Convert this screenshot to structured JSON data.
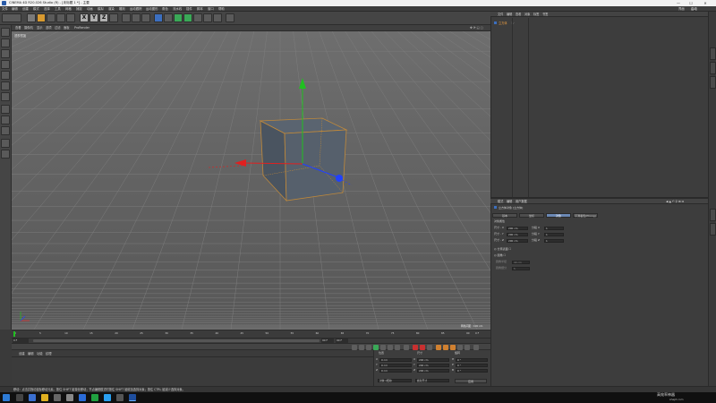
{
  "window": {
    "title": "CINEMA 4D R20.026 Studio (R) - [未标题 1 *] - 主要",
    "min": "—",
    "max": "☐",
    "close": "✕"
  },
  "menu": {
    "items": [
      "文件",
      "编辑",
      "创建",
      "模式",
      "选择",
      "工具",
      "网格",
      "捕捉",
      "动画",
      "模拟",
      "渲染",
      "雕刻",
      "运动跟踪",
      "运动图形",
      "角色",
      "流水线",
      "插件",
      "脚本",
      "窗口",
      "帮助"
    ],
    "layout_label": "界面",
    "layout_value": "启动"
  },
  "viewport": {
    "header": [
      "查看",
      "摄像机",
      "显示",
      "选项",
      "过滤",
      "面板",
      "ProRender"
    ],
    "view_name": "透视视图",
    "grid_spacing": "网格间距 : 100 cm"
  },
  "timeline": {
    "ticks": [
      "0",
      "5",
      "10",
      "15",
      "20",
      "25",
      "30",
      "35",
      "40",
      "45",
      "50",
      "55",
      "60",
      "65",
      "70",
      "75",
      "80",
      "85",
      "90"
    ],
    "frame_current": "0 F",
    "frame_start": "0 F",
    "frame_end": "90 F",
    "frame_end2": "90 F",
    "frame_label": "0 F"
  },
  "material": {
    "tabs": [
      "创建",
      "编辑",
      "功能",
      "纹理"
    ]
  },
  "coords": {
    "headers": [
      "位置",
      "尺寸",
      "旋转"
    ],
    "rows": [
      {
        "axis": "X",
        "pos": "0 cm",
        "size": "200 cm",
        "rot_label": "H",
        "rot": "0 °"
      },
      {
        "axis": "Y",
        "pos": "0 cm",
        "size": "200 cm",
        "rot_label": "P",
        "rot": "0 °"
      },
      {
        "axis": "Z",
        "pos": "0 cm",
        "size": "200 cm",
        "rot_label": "B",
        "rot": "0 °"
      }
    ],
    "mode": "对象 (相对)",
    "size_mode": "绝对尺寸",
    "apply": "应用"
  },
  "status": {
    "text": "移动：点击并拖动鼠标移动元素。按住 SHIFT 键量化移动；节点编辑模式时按住 SHIFT 键增加选择对象；按住 CTRL 键减少选择对象。"
  },
  "objects": {
    "tabs": [
      "文件",
      "编辑",
      "查看",
      "对象",
      "标签",
      "书签"
    ],
    "item": "立方体"
  },
  "attributes": {
    "tabs": [
      "模式",
      "编辑",
      "用户数据"
    ],
    "object_title": "立方体对象 [立方体]",
    "buttons": [
      "基本",
      "坐标",
      "对象",
      "平滑着色(Phong)"
    ],
    "section": "对象属性",
    "rows": [
      {
        "label": "尺寸 . X",
        "value": "200 cm",
        "seg_label": "分段 X",
        "seg": "1"
      },
      {
        "label": "尺寸 . Y",
        "value": "200 cm",
        "seg_label": "分段 Y",
        "seg": "1"
      },
      {
        "label": "尺寸 . Z",
        "value": "200 cm",
        "seg_label": "分段 Z",
        "seg": "1"
      }
    ],
    "separate": "分离表面",
    "fillet": "圆角",
    "fillet_radius_label": "圆角半径",
    "fillet_radius": "40 cm",
    "fillet_sub_label": "圆角细分",
    "fillet_sub": "5"
  },
  "taskbar": {
    "watermark": "高效率神器",
    "watermark_sub": "shejit.com"
  },
  "colors": {
    "accent_blue": "#6b88b4",
    "axis_x": "#e02020",
    "axis_y": "#20c020",
    "axis_z": "#2040ff",
    "object_orange": "#f0a040"
  }
}
